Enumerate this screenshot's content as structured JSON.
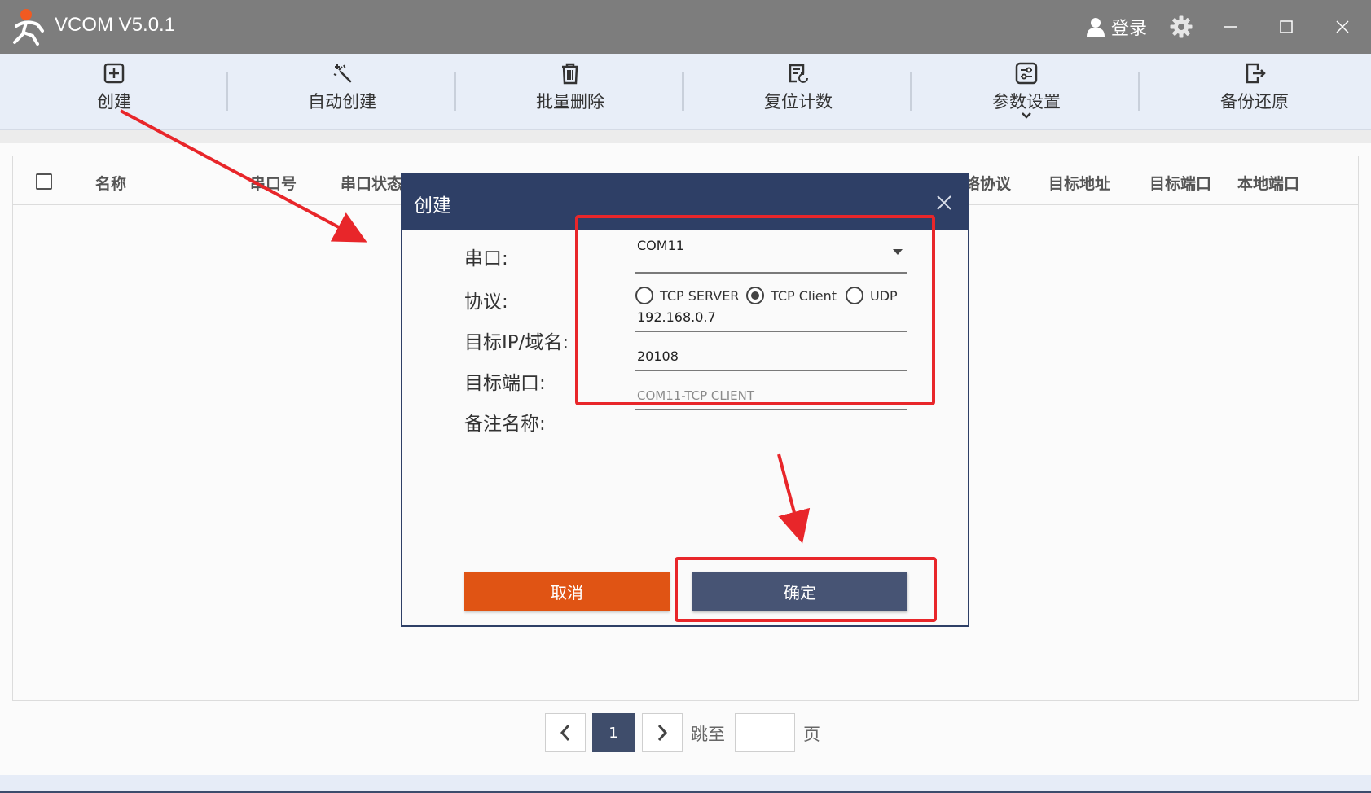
{
  "app": {
    "title": "VCOM V5.0.1",
    "login_label": "登录"
  },
  "toolbar": {
    "items": [
      {
        "label": "创建",
        "icon": "plus-square-icon"
      },
      {
        "label": "自动创建",
        "icon": "magic-wand-icon"
      },
      {
        "label": "批量删除",
        "icon": "trash-icon"
      },
      {
        "label": "复位计数",
        "icon": "reset-counter-icon"
      },
      {
        "label": "参数设置",
        "icon": "sliders-icon"
      },
      {
        "label": "备份还原",
        "icon": "export-file-icon"
      }
    ]
  },
  "table": {
    "columns": [
      "名称",
      "串口号",
      "串口状态",
      "络协议",
      "目标地址",
      "目标端口",
      "本地端口"
    ]
  },
  "pagination": {
    "current_page": "1",
    "goto_label": "跳至",
    "page_suffix": "页",
    "goto_value": ""
  },
  "dialog": {
    "title": "创建",
    "labels": {
      "port": "串口:",
      "protocol": "协议:",
      "target_ip": "目标IP/域名:",
      "target_port": "目标端口:",
      "remark": "备注名称:"
    },
    "port_value": "COM11",
    "protocol_options": [
      "TCP SERVER",
      "TCP Client",
      "UDP"
    ],
    "protocol_selected": "TCP Client",
    "target_ip_value": "192.168.0.7",
    "target_port_value": "20108",
    "remark_placeholder": "COM11-TCP CLIENT",
    "cancel_label": "取消",
    "ok_label": "确定"
  },
  "colors": {
    "titlebar": "#7d7d7d",
    "toolbar": "#e8eef8",
    "dialog_header": "#2e3f66",
    "cancel_button": "#e05414",
    "ok_button": "#475474",
    "annotation": "#e8262a"
  }
}
